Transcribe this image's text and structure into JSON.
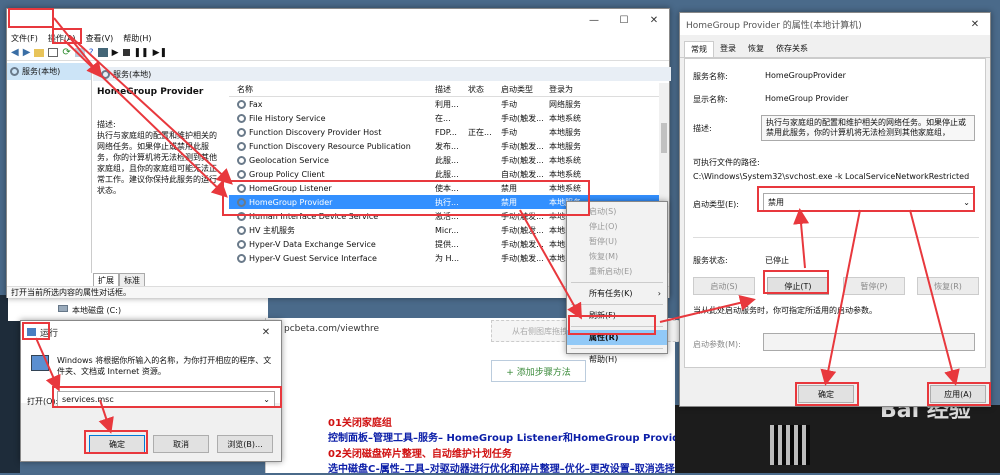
{
  "search_window": {
    "title": "服务"
  },
  "services_window": {
    "menu": [
      "文件(F)",
      "操作(A)",
      "查看(V)",
      "帮助(H)"
    ],
    "tree_item": "服务(本地)",
    "pane_header": "服务(本地)",
    "selected_title": "HomeGroup Provider",
    "desc_label": "描述:",
    "desc_text": "执行与家庭组的配置和维护相关的网络任务。如果停止或禁用此服务，你的计算机将无法检测到其他家庭组，且你的家庭组可能无法正常工作。建议你保持此服务的运行状态。",
    "columns": [
      "名称",
      "描述",
      "状态",
      "启动类型",
      "登录为"
    ],
    "rows": [
      [
        "Fax",
        "利用...",
        "",
        "手动",
        "网络服务"
      ],
      [
        "File History Service",
        "在...",
        "",
        "手动(触发...",
        "本地系统"
      ],
      [
        "Function Discovery Provider Host",
        "FDP...",
        "正在...",
        "手动",
        "本地服务"
      ],
      [
        "Function Discovery Resource Publication",
        "发布...",
        "",
        "手动(触发...",
        "本地服务"
      ],
      [
        "Geolocation Service",
        "此服...",
        "",
        "手动(触发...",
        "本地系统"
      ],
      [
        "Group Policy Client",
        "此服...",
        "",
        "自动(触发...",
        "本地系统"
      ],
      [
        "HomeGroup Listener",
        "使本...",
        "",
        "禁用",
        "本地系统"
      ],
      [
        "HomeGroup Provider",
        "执行...",
        "",
        "禁用",
        "本地服务"
      ],
      [
        "Human Interface Device Service",
        "激活...",
        "",
        "手动(触发...",
        "本地系统"
      ],
      [
        "HV 主机服务",
        "Micr...",
        "",
        "手动(触发...",
        "本地系统"
      ],
      [
        "Hyper-V Data Exchange Service",
        "提供...",
        "",
        "手动(触发...",
        "本地系统"
      ],
      [
        "Hyper-V Guest Service Interface",
        "为 H...",
        "",
        "手动(触发...",
        "本地系统"
      ]
    ],
    "tabs": [
      "扩展",
      "标准"
    ],
    "status": "打开当前所选内容的属性对话框。"
  },
  "context_menu": {
    "items": [
      "启动(S)",
      "停止(O)",
      "暂停(U)",
      "恢复(M)",
      "重新启动(E)",
      "所有任务(K)",
      "刷新(F)",
      "属性(R)",
      "帮助(H)"
    ]
  },
  "props_dialog": {
    "title": "HomeGroup Provider 的属性(本地计算机)",
    "tabs": [
      "常规",
      "登录",
      "恢复",
      "依存关系"
    ],
    "service_name_label": "服务名称:",
    "service_name": "HomeGroupProvider",
    "display_name_label": "显示名称:",
    "display_name": "HomeGroup Provider",
    "desc_label": "描述:",
    "desc": "执行与家庭组的配置和维护相关的网络任务。如果停止或禁用此服务，你的计算机将无法检测到其他家庭组，",
    "exe_label": "可执行文件的路径:",
    "exe": "C:\\Windows\\System32\\svchost.exe -k LocalServiceNetworkRestricted",
    "startup_label": "启动类型(E):",
    "startup": "禁用",
    "status_label": "服务状态:",
    "status": "已停止",
    "buttons": [
      "启动(S)",
      "停止(T)",
      "暂停(P)",
      "恢复(R)"
    ],
    "hint": "当从此处启动服务时，你可指定所适用的启动参数。",
    "param_label": "启动参数(M):",
    "ok": "确定",
    "apply": "应用(A)"
  },
  "run_dialog": {
    "title": "运行",
    "desc": "Windows 将根据你所输入的名称，为你打开相应的程序、文件夹、文档或 Internet 资源。",
    "open_label": "打开(O):",
    "value": "services.msc",
    "ok": "确定",
    "cancel": "取消",
    "browse": "浏览(B)..."
  },
  "background": {
    "explorer_item": "本地磁盘 (C:)",
    "url": "pcbeta.com/viewthre",
    "add_step": "+ 添加步骤方法",
    "upload_hint": "从右侧图库拖拽图片至此",
    "watermark": "Bai 经验",
    "tips": [
      "01关闭家庭组",
      "控制面板–管理工具–服务– HomeGroup Listener和HomeGroup Provider禁用。",
      "02关闭磁盘碎片整理、自动维护计划任务",
      "选中磁盘C-属性–工具–对驱动器进行优化和碎片整理–优化–更改设置–取消选择按计划运行。"
    ]
  }
}
